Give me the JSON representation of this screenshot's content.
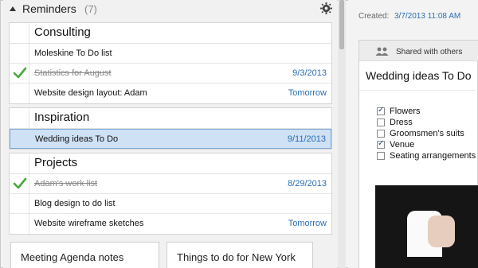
{
  "reminders": {
    "title": "Reminders",
    "count": "(7)"
  },
  "groups": [
    {
      "title": "Consulting",
      "items": [
        {
          "name": "Moleskine To Do list",
          "date": "",
          "done": false
        },
        {
          "name": "Statistics for August",
          "date": "9/3/2013",
          "done": true
        },
        {
          "name": "Website design layout: Adam",
          "date": "Tomorrow",
          "done": false
        }
      ]
    },
    {
      "title": "Inspiration",
      "items": [
        {
          "name": "Wedding ideas To Do",
          "date": "9/11/2013",
          "done": false,
          "selected": true
        }
      ]
    },
    {
      "title": "Projects",
      "items": [
        {
          "name": "Adam's work list",
          "date": "8/29/2013",
          "done": true
        },
        {
          "name": "Blog design to do list",
          "date": "",
          "done": false
        },
        {
          "name": "Website wireframe sketches",
          "date": "Tomorrow",
          "done": false
        }
      ]
    }
  ],
  "bottom_cards": [
    {
      "title": "Meeting Agenda notes"
    },
    {
      "title": "Things to do for New York"
    }
  ],
  "detail": {
    "created_label": "Created:",
    "created_date": "3/7/2013 11:08 AM",
    "shared_label": "Shared with others",
    "note_title": "Wedding ideas To Do",
    "checklist": [
      {
        "text": "Flowers",
        "checked": true
      },
      {
        "text": "Dress",
        "checked": false
      },
      {
        "text": "Groomsmen's suits",
        "checked": false
      },
      {
        "text": "Venue",
        "checked": true
      },
      {
        "text": "Seating arrangements",
        "checked": false
      }
    ]
  },
  "colors": {
    "accent": "#2a6eb5",
    "check_green": "#4aa83c",
    "selected_bg": "#cfe1f5"
  },
  "icons": {
    "gear": "gear-icon",
    "collapse": "collapse-arrow-icon",
    "check": "checkmark-icon",
    "people": "people-icon"
  }
}
